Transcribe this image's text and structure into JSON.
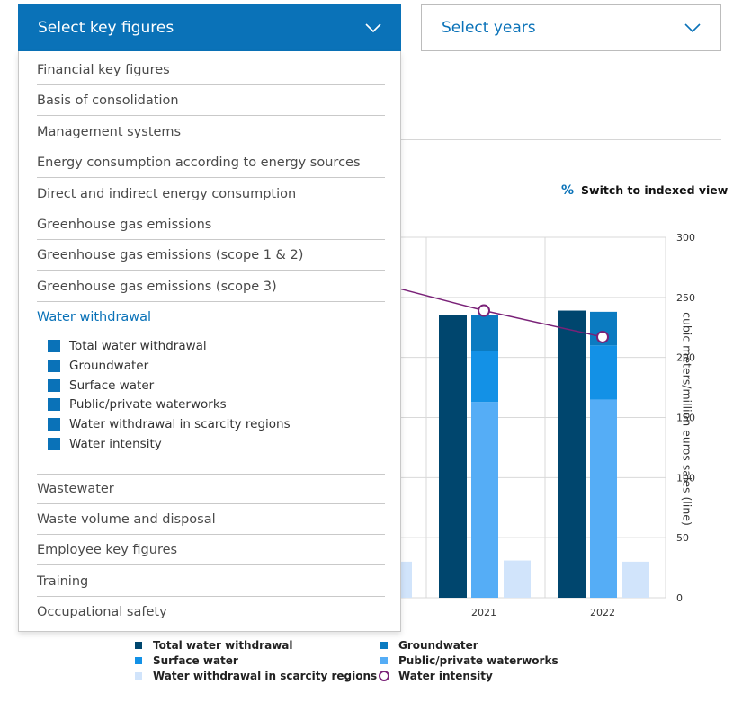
{
  "key_figures_dropdown": {
    "label": "Select key figures"
  },
  "years_dropdown": {
    "label": "Select years"
  },
  "menu": {
    "items_top": [
      "Financial key figures",
      "Basis of consolidation",
      "Management systems",
      "Energy consumption according to energy sources",
      "Direct and indirect energy consumption",
      "Greenhouse gas emissions",
      "Greenhouse gas emissions (scope 1 & 2)",
      "Greenhouse gas emissions (scope 3)"
    ],
    "active_item": "Water withdrawal",
    "sub_items": [
      "Total water withdrawal",
      "Groundwater",
      "Surface water",
      "Public/private waterworks",
      "Water withdrawal in scarcity regions",
      "Water intensity"
    ],
    "items_bottom": [
      "Wastewater",
      "Waste volume and disposal",
      "Employee key figures",
      "Training",
      "Occupational safety"
    ]
  },
  "switch_view": {
    "icon": "%",
    "label": "Switch to indexed view"
  },
  "colors": {
    "accent": "#0a72b8",
    "total": "#00466e",
    "groundwater": "#0b7bc1",
    "surface": "#1391e6",
    "waterworks": "#55adf6",
    "scarcity": "#d1e4fb",
    "intensity": "#7a2278"
  },
  "chart_data": {
    "type": "bar",
    "categories": [
      "2021",
      "2022"
    ],
    "ylabel_right": "cubic meters/million euros sales (line)",
    "right_ticks": [
      "300",
      "250",
      "200",
      "150",
      "100",
      "50",
      "0"
    ],
    "right_ylim": [
      0,
      300
    ],
    "series": [
      {
        "name": "Total water withdrawal",
        "values": [
          235,
          239
        ]
      },
      {
        "name": "Groundwater",
        "values": [
          30,
          28
        ]
      },
      {
        "name": "Surface water",
        "values": [
          42,
          45
        ]
      },
      {
        "name": "Public/private waterworks",
        "values": [
          163,
          165
        ]
      },
      {
        "name": "Water withdrawal in scarcity regions",
        "values": [
          31,
          30
        ]
      },
      {
        "name": "Water intensity",
        "type": "line",
        "values": [
          239,
          217
        ]
      }
    ],
    "legend": [
      "Total water withdrawal",
      "Groundwater",
      "Surface water",
      "Public/private waterworks",
      "Water withdrawal in scarcity regions",
      "Water intensity"
    ]
  }
}
